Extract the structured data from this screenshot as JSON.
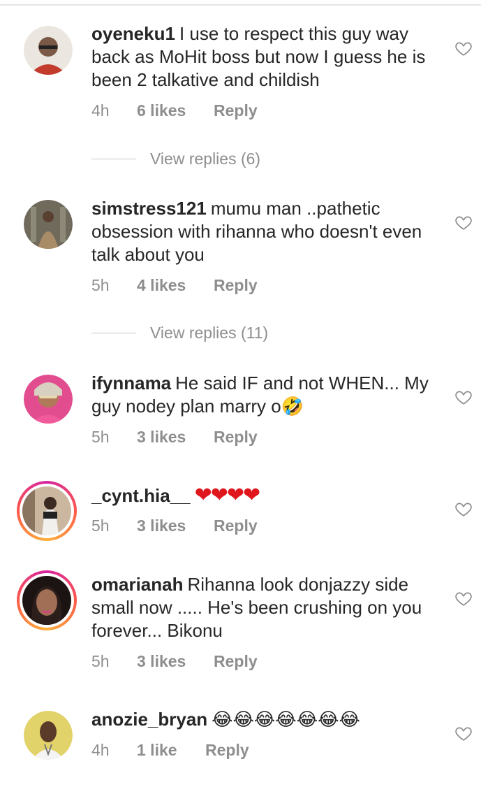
{
  "comments": [
    {
      "username": "oyeneku1",
      "text": "I use to respect this guy way back as MoHit boss but now I guess he is been 2 talkative and childish",
      "time": "4h",
      "likes": "6 likes",
      "reply": "Reply",
      "view_replies": "View replies (6)",
      "avatar_color": "#7a5a46"
    },
    {
      "username": "simstress121",
      "text": "mumu man ..pathetic obsession with rihanna who doesn't even talk about you",
      "time": "5h",
      "likes": "4 likes",
      "reply": "Reply",
      "view_replies": "View replies (11)",
      "avatar_color": "#8c7560"
    },
    {
      "username": "ifynnama",
      "text": "He said IF and not WHEN... My guy nodey plan marry o🤣",
      "time": "5h",
      "likes": "3 likes",
      "reply": "Reply",
      "avatar_color": "#c2407a"
    },
    {
      "username": "_cynt.hia__",
      "text": "❤❤❤❤",
      "time": "5h",
      "likes": "3 likes",
      "reply": "Reply",
      "avatar_color": "#b89b86"
    },
    {
      "username": "omarianah",
      "text": "Rihanna look donjazzy side small now ..... He's been crushing on you forever... Bikonu",
      "time": "5h",
      "likes": "3 likes",
      "reply": "Reply",
      "avatar_color": "#4a3530"
    },
    {
      "username": "anozie_bryan",
      "text": "😂😂😂😂😂😂😂",
      "time": "4h",
      "likes": "1 like",
      "reply": "Reply",
      "avatar_color": "#d9c85a"
    }
  ],
  "colors": {
    "text": "#262626",
    "meta": "#8e8e8e",
    "heart": "#e0161d"
  },
  "icons": {
    "like": "heart-outline-icon"
  }
}
